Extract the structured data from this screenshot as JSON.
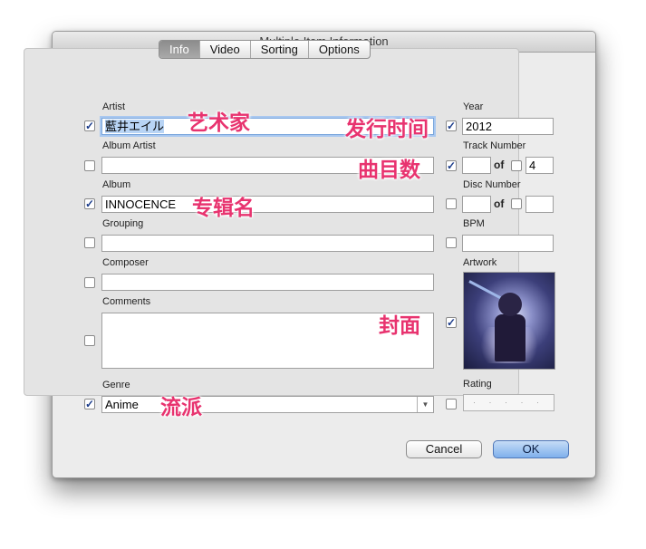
{
  "window": {
    "title": "Multiple Item Information"
  },
  "tabs": [
    "Info",
    "Video",
    "Sorting",
    "Options"
  ],
  "fields": {
    "artist": {
      "label": "Artist",
      "value": "藍井エイル",
      "checked": true
    },
    "album_artist": {
      "label": "Album Artist",
      "value": "",
      "checked": false
    },
    "album": {
      "label": "Album",
      "value": "INNOCENCE",
      "checked": true
    },
    "grouping": {
      "label": "Grouping",
      "value": "",
      "checked": false
    },
    "composer": {
      "label": "Composer",
      "value": "",
      "checked": false
    },
    "comments": {
      "label": "Comments",
      "value": "",
      "checked": false
    },
    "genre": {
      "label": "Genre",
      "value": "Anime",
      "checked": true
    },
    "year": {
      "label": "Year",
      "value": "2012",
      "checked": true
    },
    "track_number": {
      "label": "Track Number",
      "value": "",
      "of_label": "of",
      "of_value": "4",
      "checked": true,
      "of_checked": false
    },
    "disc_number": {
      "label": "Disc Number",
      "value": "",
      "of_label": "of",
      "of_value": "",
      "checked": false,
      "of_checked": false
    },
    "bpm": {
      "label": "BPM",
      "value": "",
      "checked": false
    },
    "artwork": {
      "label": "Artwork",
      "checked": true
    },
    "rating": {
      "label": "Rating",
      "value": "· · · · ·",
      "checked": false
    }
  },
  "checkmark": "✓",
  "annotations": {
    "artist": "艺术家",
    "year": "发行时间",
    "track": "曲目数",
    "album": "专辑名",
    "artwork": "封面",
    "genre": "流派"
  },
  "buttons": {
    "cancel": "Cancel",
    "ok": "OK"
  }
}
